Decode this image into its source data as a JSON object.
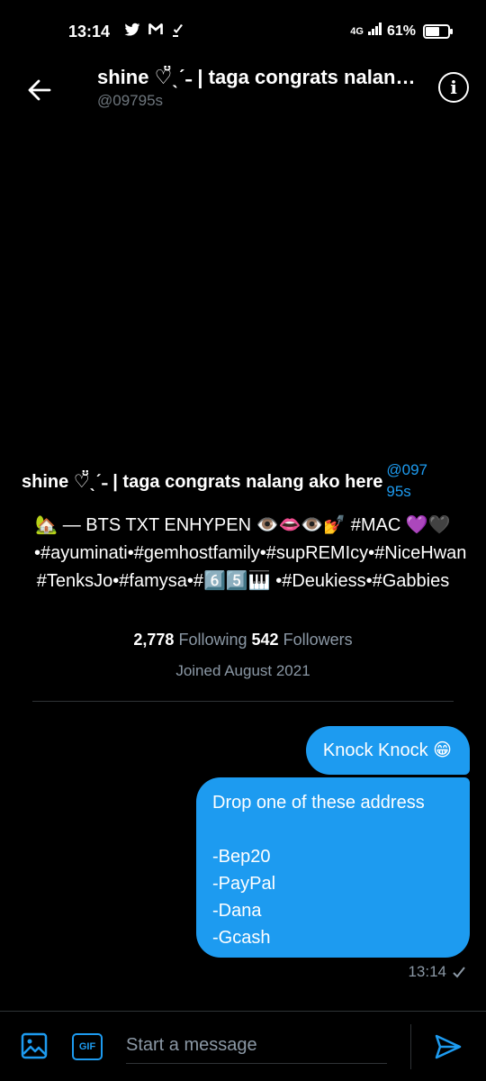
{
  "status_bar": {
    "time": "13:14",
    "notif_icons": [
      "twitter-icon",
      "gmail-icon",
      "app-notification-icon"
    ],
    "network": "4G",
    "battery": "61%",
    "battery_level": 0.61
  },
  "header": {
    "title": "shine ♡̆̈ˎˊ˗ | taga congrats nalang ako here",
    "handle": "@09795s"
  },
  "profile": {
    "name": "shine ♡̆̈ˎˊ˗ | taga congrats nalang ako here",
    "handle": "@09795s",
    "bio": "🏡 — BTS TXT ENHYPEN 👁️👄👁️💅 #MAC 💜🖤•#ayuminati•#gemhostfamily•#supREMIcy•#NiceHwan #TenksJo•#famysa•#6️⃣5️⃣🎹 •#Deukiess•#Gabbies",
    "following_count": "2,778",
    "following_label": "Following",
    "followers_count": "542",
    "followers_label": "Followers",
    "joined": "Joined August 2021"
  },
  "messages": [
    {
      "text": "Knock Knock 😁"
    },
    {
      "text": "Drop one of these address\n\n-Bep20\n-PayPal\n-Dana\n-Gcash"
    }
  ],
  "message_time": "13:14",
  "composer": {
    "placeholder": "Start a message",
    "gif_label": "GIF"
  },
  "colors": {
    "accent": "#1d9bf0",
    "background": "#000000",
    "muted": "#8b98a5"
  }
}
